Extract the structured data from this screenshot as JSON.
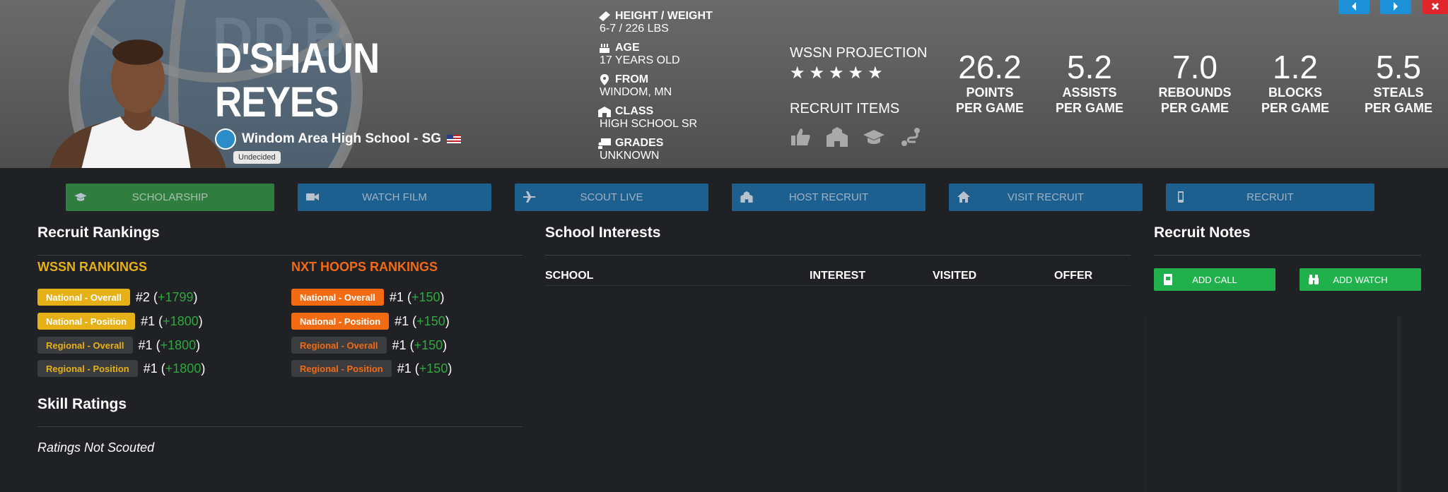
{
  "player": {
    "first_name": "D'SHAUN",
    "last_name": "REYES",
    "school_line": "Windom Area High School - SG",
    "status": "Undecided"
  },
  "bio": [
    {
      "label": "HEIGHT / WEIGHT",
      "value": "6-7 / 226 LBS",
      "icon": "ruler-icon"
    },
    {
      "label": "AGE",
      "value": "17 YEARS OLD",
      "icon": "cake-icon"
    },
    {
      "label": "FROM",
      "value": "WINDOM, MN",
      "icon": "map-pin-icon"
    },
    {
      "label": "CLASS",
      "value": "HIGH SCHOOL SR",
      "icon": "school-icon"
    },
    {
      "label": "GRADES",
      "value": "UNKNOWN",
      "icon": "chalkboard-icon"
    }
  ],
  "projection": {
    "title": "WSSN PROJECTION",
    "stars": 5,
    "items_title": "RECRUIT ITEMS",
    "item_icons": [
      "thumbs-up-icon",
      "school-building-icon",
      "graduation-cap-icon",
      "route-icon"
    ]
  },
  "stats": [
    {
      "value": "26.2",
      "label1": "POINTS",
      "label2": "PER GAME"
    },
    {
      "value": "5.2",
      "label1": "ASSISTS",
      "label2": "PER GAME"
    },
    {
      "value": "7.0",
      "label1": "REBOUNDS",
      "label2": "PER GAME"
    },
    {
      "value": "1.2",
      "label1": "BLOCKS",
      "label2": "PER GAME"
    },
    {
      "value": "5.5",
      "label1": "STEALS",
      "label2": "PER GAME"
    }
  ],
  "actions": [
    {
      "label": "SCHOLARSHIP",
      "icon": "graduation-cap-icon",
      "color": "#2f7d3f"
    },
    {
      "label": "WATCH FILM",
      "icon": "video-camera-icon",
      "color": "#1d5f8f"
    },
    {
      "label": "SCOUT LIVE",
      "icon": "plane-icon",
      "color": "#1d5f8f"
    },
    {
      "label": "HOST RECRUIT",
      "icon": "school-building-icon",
      "color": "#1d5f8f"
    },
    {
      "label": "VISIT RECRUIT",
      "icon": "home-icon",
      "color": "#1d5f8f"
    },
    {
      "label": "RECRUIT",
      "icon": "phone-icon",
      "color": "#1d5f8f"
    }
  ],
  "rankings": {
    "title": "Recruit Rankings",
    "wssn": {
      "heading": "WSSN RANKINGS",
      "color": "#e6b117",
      "rows": [
        {
          "label": "National - Overall",
          "rank": "#2",
          "open": "(",
          "delta": "+1799",
          "close": ")"
        },
        {
          "label": "National - Position",
          "rank": "#1",
          "open": "(",
          "delta": "+1800",
          "close": ")"
        },
        {
          "label": "Regional - Overall",
          "rank": "#1",
          "open": "(",
          "delta": "+1800",
          "close": ")"
        },
        {
          "label": "Regional - Position",
          "rank": "#1",
          "open": "(",
          "delta": "+1800",
          "close": ")"
        }
      ]
    },
    "nxt": {
      "heading": "NXT HOOPS RANKINGS",
      "color": "#f26a12",
      "rows": [
        {
          "label": "National - Overall",
          "rank": "#1",
          "open": "(",
          "delta": "+150",
          "close": ")"
        },
        {
          "label": "National - Position",
          "rank": "#1",
          "open": "(",
          "delta": "+150",
          "close": ")"
        },
        {
          "label": "Regional - Overall",
          "rank": "#1",
          "open": "(",
          "delta": "+150",
          "close": ")"
        },
        {
          "label": "Regional - Position",
          "rank": "#1",
          "open": "(",
          "delta": "+150",
          "close": ")"
        }
      ]
    }
  },
  "skills": {
    "title": "Skill Ratings",
    "empty_text": "Ratings Not Scouted"
  },
  "interests": {
    "title": "School Interests",
    "columns": [
      "SCHOOL",
      "INTEREST",
      "VISITED",
      "OFFER"
    ]
  },
  "notes": {
    "title": "Recruit Notes",
    "add_call": "ADD CALL",
    "add_watch": "ADD WATCH"
  },
  "colors": {
    "nav_prev": "#1e90d8",
    "nav_next": "#1e90d8",
    "nav_close": "#e0262a"
  }
}
